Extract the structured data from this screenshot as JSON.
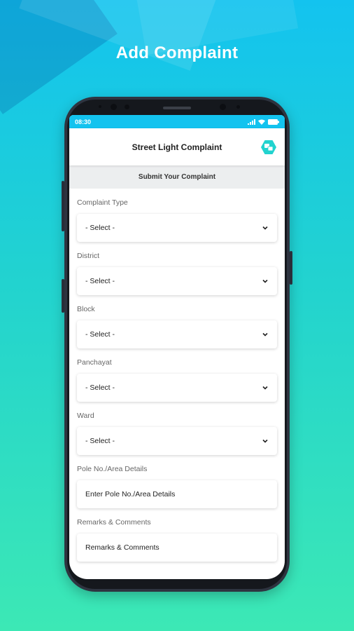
{
  "headline": "Add Complaint",
  "status": {
    "time": "08:30"
  },
  "appbar": {
    "title": "Street Light Complaint",
    "lang_icon": "translate-icon"
  },
  "section": {
    "title": "Submit Your Complaint"
  },
  "form": {
    "fields": [
      {
        "label": "Complaint Type",
        "value": "- Select -",
        "kind": "select"
      },
      {
        "label": "District",
        "value": "- Select -",
        "kind": "select"
      },
      {
        "label": "Block",
        "value": "- Select -",
        "kind": "select"
      },
      {
        "label": "Panchayat",
        "value": "- Select -",
        "kind": "select"
      },
      {
        "label": "Ward",
        "value": "- Select -",
        "kind": "select"
      },
      {
        "label": "Pole No./Area Details",
        "value": "Enter Pole No./Area Details",
        "kind": "input"
      },
      {
        "label": "Remarks & Comments",
        "value": "Remarks & Comments",
        "kind": "input"
      }
    ]
  },
  "colors": {
    "accent": "#13c3ef",
    "gradient_end": "#3ce8b5",
    "lang_badge": "#22d3cf"
  }
}
